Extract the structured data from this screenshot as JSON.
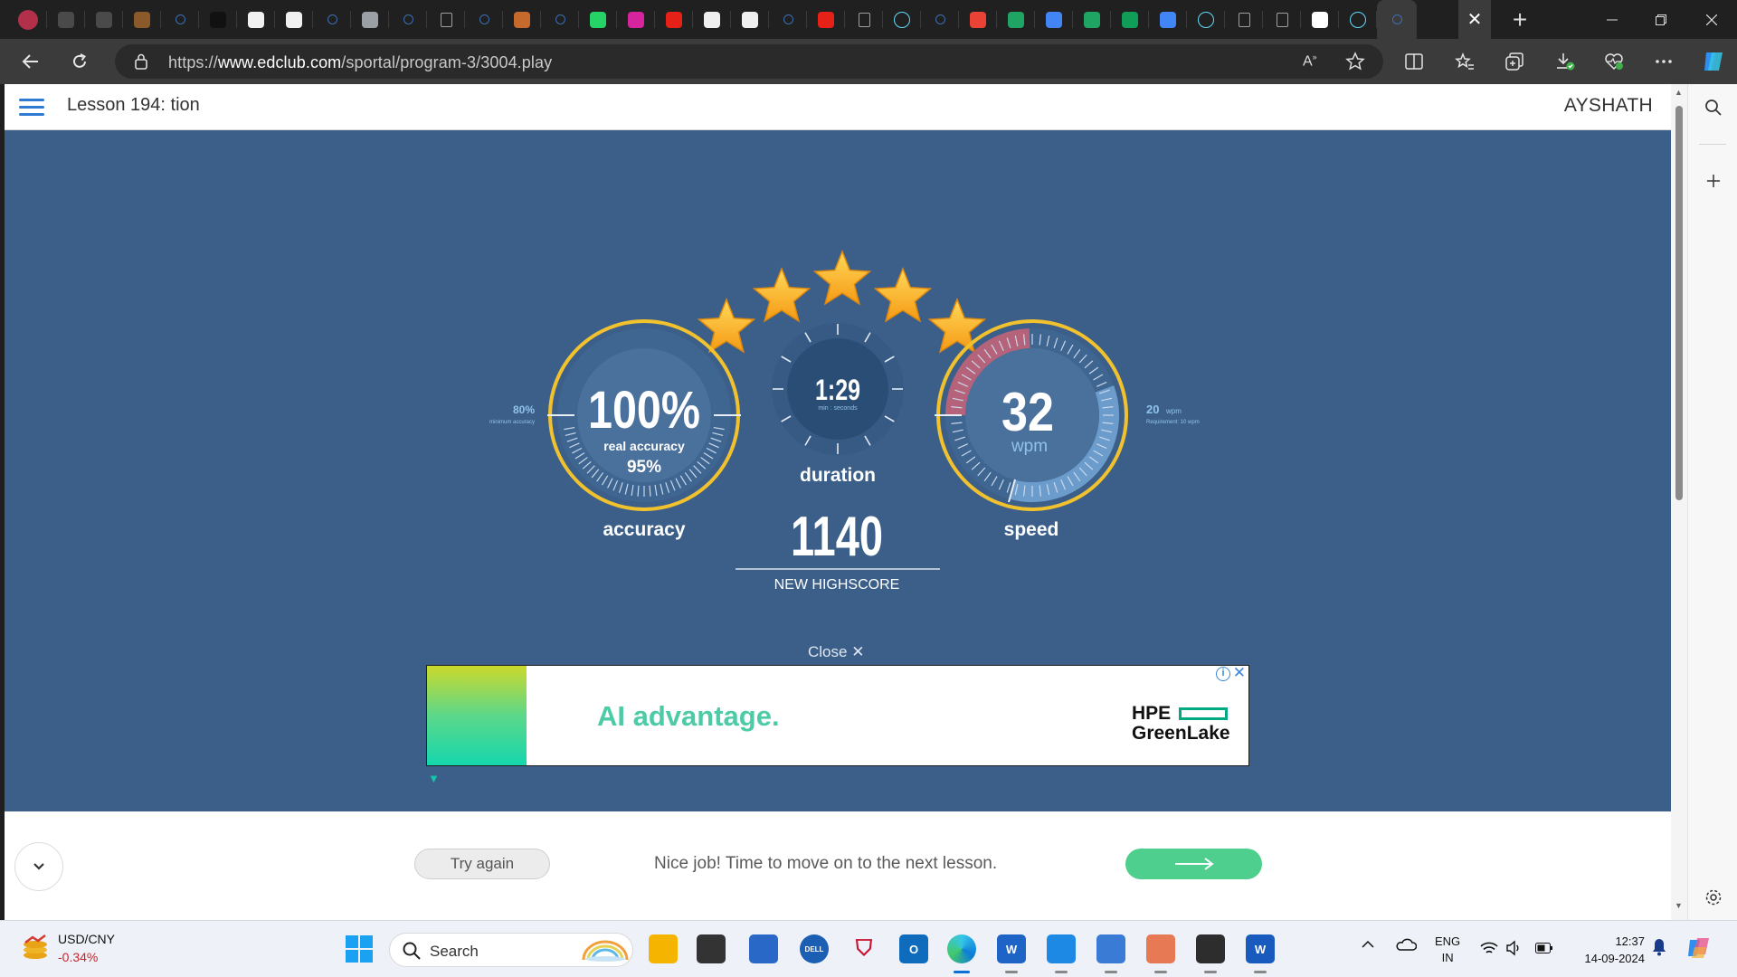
{
  "browser": {
    "url_prefix": "https://",
    "url_host": "www.edclub.com",
    "url_path": "/sportal/program-3/3004.play",
    "tabs": [
      {
        "icon": "profile-avatar-icon",
        "color": "#b3304b"
      },
      {
        "icon": "workspaces-icon",
        "color": "#4a4a4a"
      },
      {
        "icon": "tab-actions-icon",
        "color": "#4a4a4a"
      },
      {
        "icon": "image-tab-icon",
        "color": "#8a5a2b"
      },
      {
        "icon": "search-tab-icon",
        "color": "#3b6fb3"
      },
      {
        "icon": "medium-icon",
        "color": "#111111"
      },
      {
        "icon": "github-icon",
        "color": "#f0f0f0"
      },
      {
        "icon": "chatgpt-icon",
        "color": "#f0f0f0"
      },
      {
        "icon": "search-tab-icon",
        "color": "#3b6fb3"
      },
      {
        "icon": "copilot-icon",
        "color": "#9aa0a6"
      },
      {
        "icon": "search-tab-icon",
        "color": "#3b6fb3"
      },
      {
        "icon": "page-icon",
        "color": "#9aa0a6"
      },
      {
        "icon": "search-tab-icon",
        "color": "#3b6fb3"
      },
      {
        "icon": "codepen-icon",
        "color": "#c56a2c"
      },
      {
        "icon": "search-tab-icon",
        "color": "#3b6fb3"
      },
      {
        "icon": "whatsapp-icon",
        "color": "#25d366"
      },
      {
        "icon": "instagram-icon",
        "color": "#d6249f"
      },
      {
        "icon": "youtube-icon",
        "color": "#e62117"
      },
      {
        "icon": "github-icon",
        "color": "#f0f0f0"
      },
      {
        "icon": "github-icon",
        "color": "#f0f0f0"
      },
      {
        "icon": "search-tab-icon",
        "color": "#3b6fb3"
      },
      {
        "icon": "youtube-icon",
        "color": "#e62117"
      },
      {
        "icon": "page-icon",
        "color": "#9aa0a6"
      },
      {
        "icon": "react-icon",
        "color": "#61dafb"
      },
      {
        "icon": "search-tab-icon",
        "color": "#3b6fb3"
      },
      {
        "icon": "gmail-icon",
        "color": "#ea4335"
      },
      {
        "icon": "google-drive-icon",
        "color": "#1fa463"
      },
      {
        "icon": "google-docs-icon",
        "color": "#4285f4"
      },
      {
        "icon": "google-drive-icon",
        "color": "#1fa463"
      },
      {
        "icon": "google-sheets-icon",
        "color": "#0f9d58"
      },
      {
        "icon": "google-docs-icon",
        "color": "#4285f4"
      },
      {
        "icon": "react-icon",
        "color": "#61dafb"
      },
      {
        "icon": "page-icon",
        "color": "#9aa0a6"
      },
      {
        "icon": "incognito-page-icon",
        "color": "#9aa0a6"
      },
      {
        "icon": "y-combinator-icon",
        "color": "#ffffff"
      },
      {
        "icon": "react-icon",
        "color": "#61dafb"
      },
      {
        "icon": "search-tab-icon",
        "color": "#3b6fb3"
      }
    ]
  },
  "page": {
    "lesson_title": "Lesson 194: tion",
    "username": "AYSHATH"
  },
  "results": {
    "stars_earned": 5,
    "accuracy": {
      "value": "100%",
      "sub_label": "real accuracy",
      "sub_value": "95%",
      "label": "accuracy",
      "min_value": "80%",
      "min_label": "minimum accuracy",
      "gauge_fraction": 1.0
    },
    "duration": {
      "value": "1:29",
      "unit": "min : seconds",
      "label": "duration"
    },
    "speed": {
      "value": "32",
      "unit": "wpm",
      "label": "speed",
      "req_value": "20",
      "req_unit": "wpm",
      "req_label": "Requirement: 10 wpm"
    },
    "score": {
      "value": "1140",
      "label": "NEW HIGHSCORE"
    },
    "colors": {
      "background": "#3c5f8a",
      "ring": "#f2c12e",
      "gauge_red": "#b5637a",
      "gauge_blue": "#6c9ccb"
    }
  },
  "ad": {
    "close_label": "Close",
    "headline": "AI advantage.",
    "brand_line1": "HPE",
    "brand_line2": "GreenLake"
  },
  "footer": {
    "try_again": "Try again",
    "message": "Nice job! Time to move on to the next lesson."
  },
  "taskbar": {
    "weather_title": "USD/CNY",
    "weather_value": "-0.34%",
    "search_label": "Search",
    "lang_line1": "ENG",
    "lang_line2": "IN",
    "time": "12:37",
    "date": "14-09-2024",
    "apps": [
      {
        "icon": "file-explorer-icon",
        "color": "#f4b400",
        "label": ""
      },
      {
        "icon": "task-view-icon",
        "color": "#333333",
        "label": ""
      },
      {
        "icon": "microsoft-store-icon",
        "color": "#2a68c8",
        "label": ""
      },
      {
        "icon": "dell-icon",
        "color": "#1a5fb4",
        "label": "DELL"
      },
      {
        "icon": "mcafee-icon",
        "color": "#c8102e",
        "label": ""
      },
      {
        "icon": "outlook-icon",
        "color": "#0f6cbd",
        "label": "O"
      },
      {
        "icon": "edge-icon",
        "color": "#0c7bd8",
        "label": ""
      },
      {
        "icon": "wordweb-icon",
        "color": "#1e63c6",
        "label": "W"
      },
      {
        "icon": "vscode-icon",
        "color": "#1e88e5",
        "label": ""
      },
      {
        "icon": "notepad-icon",
        "color": "#3a7bd5",
        "label": ""
      },
      {
        "icon": "git-icon",
        "color": "#e77a55",
        "label": ""
      },
      {
        "icon": "terminal-icon",
        "color": "#2d2d2d",
        "label": ""
      },
      {
        "icon": "word-icon",
        "color": "#185abd",
        "label": "W"
      }
    ]
  }
}
